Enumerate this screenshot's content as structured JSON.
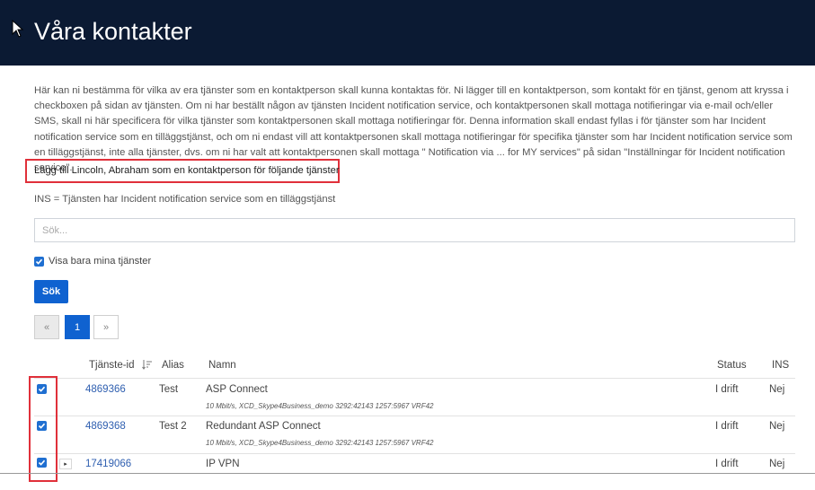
{
  "page": {
    "title": "Våra kontakter"
  },
  "intro": {
    "text": "Här kan ni bestämma för vilka av era tjänster som en kontaktperson skall kunna kontaktas för. Ni lägger till en kontaktperson, som kontakt för en tjänst, genom att kryssa i checkboxen på sidan av tjänsten. Om ni har beställt någon av tjänsten Incident notification service, och kontaktpersonen skall mottaga notifieringar via e-mail och/eller SMS, skall ni här specificera för vilka tjänster som kontaktpersonen skall mottaga notifieringar för. Denna information skall endast fyllas i för tjänster som har Incident notification service som en tilläggstjänst, och om ni endast vill att kontaktpersonen skall mottaga notifieringar för specifika tjänster som har Incident notification service som en tilläggstjänst, inte alla tjänster, dvs. om ni har valt att kontaktpersonen skall mottaga \" Notification via ... for MY services\" på sidan \"Inställningar för Incident notification service\"."
  },
  "add_contact": {
    "text": "Lägg till Lincoln, Abraham som en kontaktperson för följande tjänster"
  },
  "ins_note": "INS = Tjänsten har Incident notification service som en tilläggstjänst",
  "search": {
    "placeholder": "Sök...",
    "value": ""
  },
  "filter": {
    "label": "Visa bara mina tjänster",
    "checked": true
  },
  "search_button": "Sök",
  "pagination": {
    "prev": "«",
    "current": "1",
    "next": "»"
  },
  "table": {
    "headers": {
      "id": "Tjänste-id",
      "alias": "Alias",
      "name": "Namn",
      "status": "Status",
      "ins": "INS"
    },
    "rows": [
      {
        "id": "4869366",
        "alias": "Test",
        "name": "ASP Connect",
        "sub": "10 Mbit/s, XCD_Skype4Business_demo 3292:42143 1257:5967 VRF42",
        "status": "I drift",
        "ins": "Nej",
        "checked": true
      },
      {
        "id": "4869368",
        "alias": "Test 2",
        "name": "Redundant ASP Connect",
        "sub": "10 Mbit/s, XCD_Skype4Business_demo 3292:42143 1257:5967 VRF42",
        "status": "I drift",
        "ins": "Nej",
        "checked": true
      },
      {
        "id": "17419066",
        "alias": "",
        "name": "IP VPN",
        "sub": "",
        "status": "I drift",
        "ins": "Nej",
        "checked": true,
        "expand": "▸"
      }
    ]
  },
  "colors": {
    "header_bg": "#0b1a33",
    "accent": "#0f62d0",
    "highlight": "#e0303a",
    "link": "#2f5fb0"
  }
}
